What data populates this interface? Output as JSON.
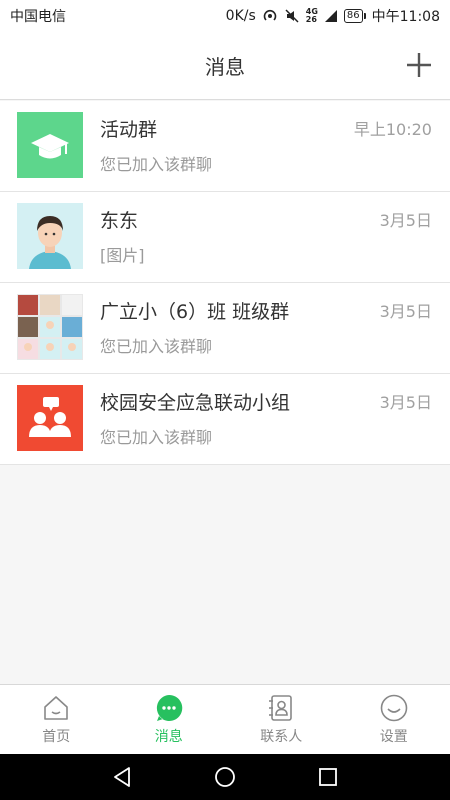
{
  "status_bar": {
    "carrier": "中国电信",
    "speed": "0K/s",
    "network_top": "4G",
    "network_bottom": "26",
    "battery": "86",
    "time": "中午11:08"
  },
  "header": {
    "title": "消息"
  },
  "conversations": [
    {
      "name": "活动群",
      "preview": "您已加入该群聊",
      "time": "早上10:20",
      "avatar": "graduation-cap-icon",
      "avatar_color": "#5dd68c"
    },
    {
      "name": "东东",
      "preview": "[图片]",
      "time": "3月5日",
      "avatar": "person-avatar",
      "avatar_color": "#d4f0f3"
    },
    {
      "name": "广立小（6）班 班级群",
      "preview": "您已加入该群聊",
      "time": "3月5日",
      "avatar": "group-photo-grid",
      "avatar_color": "#e8e8e8"
    },
    {
      "name": "校园安全应急联动小组",
      "preview": "您已加入该群聊",
      "time": "3月5日",
      "avatar": "group-chat-icon",
      "avatar_color": "#f04a32"
    }
  ],
  "tabs": [
    {
      "label": "首页",
      "icon": "home-icon",
      "active": false
    },
    {
      "label": "消息",
      "icon": "message-icon",
      "active": true
    },
    {
      "label": "联系人",
      "icon": "contacts-icon",
      "active": false
    },
    {
      "label": "设置",
      "icon": "settings-smile-icon",
      "active": false
    }
  ],
  "colors": {
    "accent": "#27c05f",
    "inactive": "#888888"
  }
}
